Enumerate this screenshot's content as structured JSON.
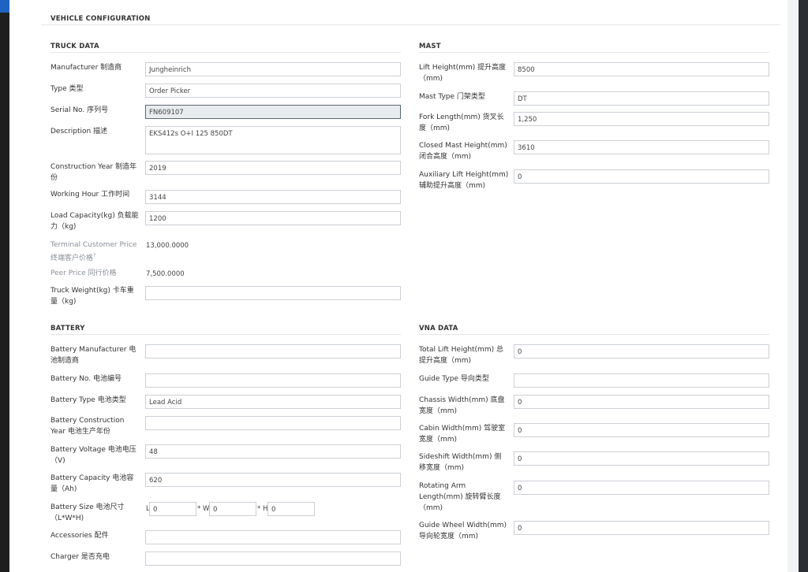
{
  "section_title": "VEHICLE CONFIGURATION",
  "truck": {
    "title": "TRUCK DATA",
    "manufacturer": {
      "label": "Manufacturer 制造商",
      "value": "Jungheinrich"
    },
    "type": {
      "label": "Type 类型",
      "value": "Order Picker"
    },
    "serial": {
      "label": "Serial No. 序列号",
      "value": "FN609107"
    },
    "description": {
      "label": "Description 描述",
      "value": "EKS412s O+I 125 850DT"
    },
    "construction_year": {
      "label1": "Construction Year 制造年",
      "label2": "份",
      "value": "2019"
    },
    "working_hour": {
      "label": "Working Hour 工作时间",
      "value": "3144"
    },
    "load_capacity": {
      "label1": "Load Capacity(kg) 负载能",
      "label2": "力（kg)",
      "value": "1200"
    },
    "terminal_price": {
      "label1": "Terminal Customer Price",
      "label2": "终端客户价格",
      "sup": "?",
      "value": "13,000.0000"
    },
    "peer_price": {
      "label": "Peer Price 同行价格",
      "value": "7,500.0000"
    },
    "truck_weight": {
      "label1": "Truck Weight(kg) 卡车重",
      "label2": "量（kg)",
      "value": ""
    }
  },
  "mast": {
    "title": "MAST",
    "lift_height": {
      "label1": "Lift Height(mm) 提升高度",
      "label2": "（mm)",
      "value": "8500"
    },
    "mast_type": {
      "label": "Mast Type 门架类型",
      "value": "DT"
    },
    "fork_length": {
      "label1": "Fork Length(mm) 货叉长",
      "label2": "度（mm)",
      "value": "1,250"
    },
    "closed_mast_height": {
      "label1": "Closed Mast Height(mm)",
      "label2": "闭合高度（mm)",
      "value": "3610"
    },
    "aux_lift_height": {
      "label1": "Auxiliary Lift Height(mm)",
      "label2": "辅助提升高度（mm)",
      "value": "0"
    }
  },
  "battery": {
    "title": "BATTERY",
    "manufacturer": {
      "label1": "Battery Manufacturer 电",
      "label2": "池制造商",
      "value": ""
    },
    "number": {
      "label": "Battery No. 电池编号",
      "value": ""
    },
    "type": {
      "label": "Battery Type 电池类型",
      "value": "Lead Acid"
    },
    "construction_year": {
      "label1": "Battery Construction",
      "label2": "Year 电池生产年份",
      "value": ""
    },
    "voltage": {
      "label1": "Battery Voltage 电池电压",
      "label2": "（V)",
      "value": "48"
    },
    "capacity": {
      "label1": "Battery Capacity 电池容",
      "label2": "量（Ah)",
      "value": "620"
    },
    "size": {
      "label1": "Battery Size 电池尺寸",
      "label2": "（L*W*H)",
      "l_prefix": "L",
      "l": "0",
      "w_prefix": "* W",
      "w": "0",
      "h_prefix": "* H",
      "h": "0"
    },
    "accessories": {
      "label": "Accessories 配件",
      "value": ""
    },
    "charger": {
      "label": "Charger 是否充电",
      "value": ""
    }
  },
  "vna": {
    "title": "VNA DATA",
    "total_lift_height": {
      "label1": "Total Lift Height(mm) 总",
      "label2": "提升高度（mm)",
      "value": "0"
    },
    "guide_type": {
      "label": "Guide Type 导向类型",
      "value": ""
    },
    "chassis_width": {
      "label1": "Chassis Width(mm) 底盘",
      "label2": "宽度（mm)",
      "value": "0"
    },
    "cabin_width": {
      "label1": "Cabin Width(mm) 驾驶室",
      "label2": "宽度（mm)",
      "value": "0"
    },
    "sideshift_width": {
      "label1": "Sideshift Width(mm) 侧",
      "label2": "移宽度（mm)",
      "value": "0"
    },
    "rotating_arm_length": {
      "label1": "Rotating Arm",
      "label2": "Length(mm) 旋转臂长度",
      "label3": "（mm)",
      "value": "0"
    },
    "guide_wheel_width": {
      "label1": "Guide Wheel Width(mm)",
      "label2": "导向轮宽度（mm)",
      "value": "0"
    }
  }
}
